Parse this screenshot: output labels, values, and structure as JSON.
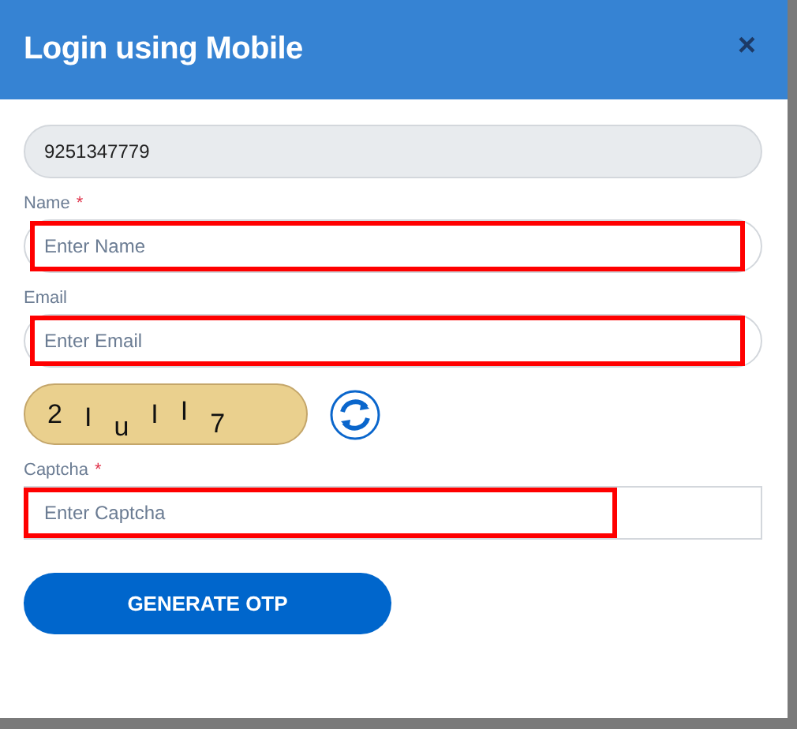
{
  "dialog": {
    "title": "Login using Mobile",
    "close": "×"
  },
  "fields": [
    {
      "kind": "readonly",
      "value": "9251347779",
      "highlighted": false
    },
    {
      "kind": "text",
      "label": "Name",
      "required_mark": "*",
      "placeholder": "Enter Name",
      "highlighted": true
    },
    {
      "kind": "text",
      "label": "Email",
      "placeholder": "Enter Email",
      "highlighted": true
    },
    {
      "kind": "captcha",
      "chars": [
        "2",
        "I",
        "u",
        "I",
        "I",
        "7"
      ]
    },
    {
      "kind": "box",
      "label": "Captcha",
      "required_mark": "*",
      "placeholder": "Enter Captcha",
      "highlighted": true
    }
  ],
  "button": "GENERATE OTP"
}
